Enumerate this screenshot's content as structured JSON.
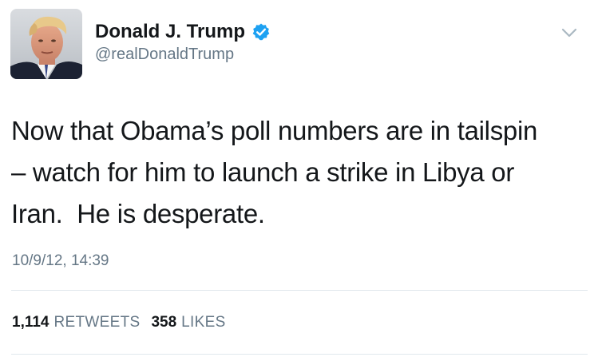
{
  "tweet": {
    "author": {
      "display_name": "Donald J. Trump",
      "handle": "@realDonaldTrump",
      "verified": true,
      "avatar": "profile-photo"
    },
    "text": "Now that Obama’s poll numbers are in tailspin\n– watch for him to launch a strike in Libya or\nIran.  He is desperate.",
    "timestamp": "10/9/12, 14:39",
    "stats": {
      "retweets": {
        "count": "1,114",
        "label": "RETWEETS"
      },
      "likes": {
        "count": "358",
        "label": "LIKES"
      }
    }
  },
  "icons": {
    "verified": "verified-badge-icon",
    "menu": "chevron-down-icon"
  },
  "colors": {
    "verified_blue": "#1da1f2",
    "text_primary": "#14171a",
    "text_secondary": "#657786",
    "divider": "#e1e8ed"
  }
}
